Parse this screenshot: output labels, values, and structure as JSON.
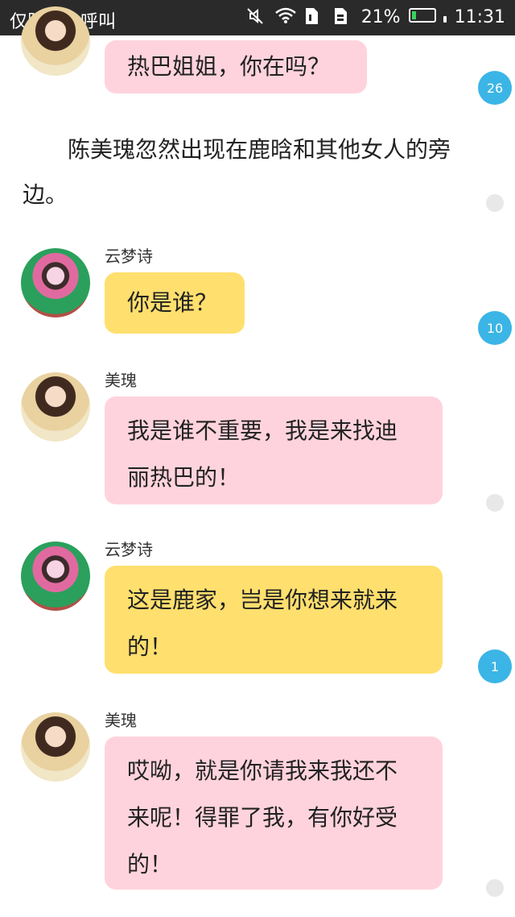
{
  "status_bar": {
    "carrier_text": "仅限紧急呼叫",
    "battery_percent": "21%",
    "time": "11:31",
    "battery_level": 0.21,
    "icons": [
      "mute-icon",
      "wifi-icon",
      "sim1-icon",
      "sim2-icon",
      "battery-charging-icon"
    ]
  },
  "messages": [
    {
      "sender": "",
      "avatar": "meigui",
      "text": "热巴姐姐，你在吗？",
      "color": "#ffd3dd",
      "comment_count": "26"
    },
    {
      "narration": "陈美瑰忽然出现在鹿晗和其他女人的旁边。"
    },
    {
      "sender": "云梦诗",
      "avatar": "yunmengshi",
      "text": "你是谁？",
      "color": "#ffdf6e",
      "comment_count": "10"
    },
    {
      "sender": "美瑰",
      "avatar": "meigui",
      "lines": [
        "我是谁不重要，我是来找迪",
        "丽热巴的！"
      ],
      "color": "#ffd3dd"
    },
    {
      "sender": "云梦诗",
      "avatar": "yunmengshi",
      "lines": [
        "这是鹿家，岂是你想来就来",
        "的！"
      ],
      "color": "#ffdf6e",
      "comment_count": "1"
    },
    {
      "sender": "美瑰",
      "avatar": "meigui",
      "lines": [
        "哎呦，就是你请我来我还不",
        "来呢！得罪了我，有你好受",
        "的！"
      ],
      "color": "#ffd3dd"
    }
  ],
  "colors": {
    "status_bar_bg": "#2a2a2a",
    "badge_blue": "#3bb5e6",
    "pink_bubble": "#ffd3dd",
    "yellow_bubble": "#ffdf6e"
  }
}
